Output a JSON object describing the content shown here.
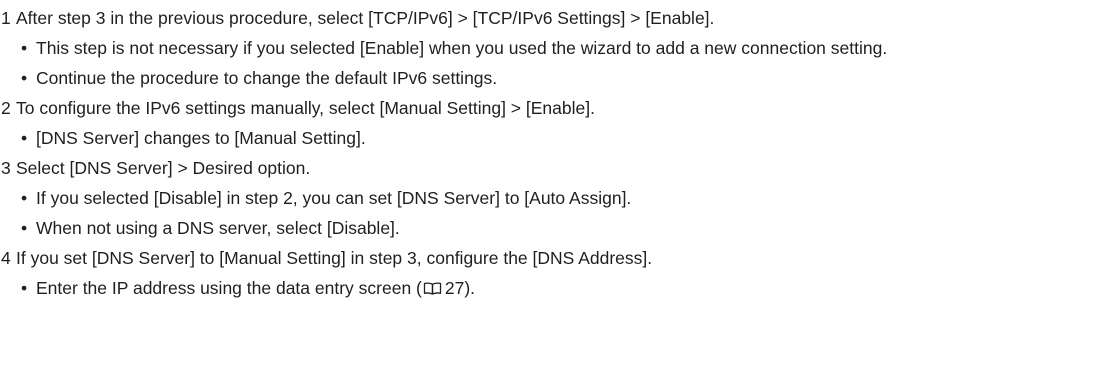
{
  "steps": [
    {
      "number": "1",
      "text": "After step 3 in the previous procedure, select [TCP/IPv6] > [TCP/IPv6 Settings] > [Enable].",
      "bullets": [
        "This step is not necessary if you selected [Enable] when you used the wizard to add a new connection setting.",
        "Continue the procedure to change the default IPv6 settings."
      ]
    },
    {
      "number": "2",
      "text": "To configure the IPv6 settings manually, select [Manual Setting] > [Enable].",
      "bullets": [
        "[DNS Server] changes to [Manual Setting]."
      ]
    },
    {
      "number": "3",
      "text": "Select [DNS Server] > Desired option.",
      "bullets": [
        "If you selected [Disable] in step 2, you can set [DNS Server] to [Auto Assign].",
        "When not using a DNS server, select [Disable]."
      ]
    },
    {
      "number": "4",
      "text": "If you set [DNS Server] to [Manual Setting] in step 3, configure the [DNS Address].",
      "bullets": []
    }
  ],
  "last_bullet": {
    "before": "Enter the IP address using the data entry screen (",
    "icon": "book-icon",
    "page_ref": "27",
    "after": ")."
  },
  "bullet_glyph": "•"
}
